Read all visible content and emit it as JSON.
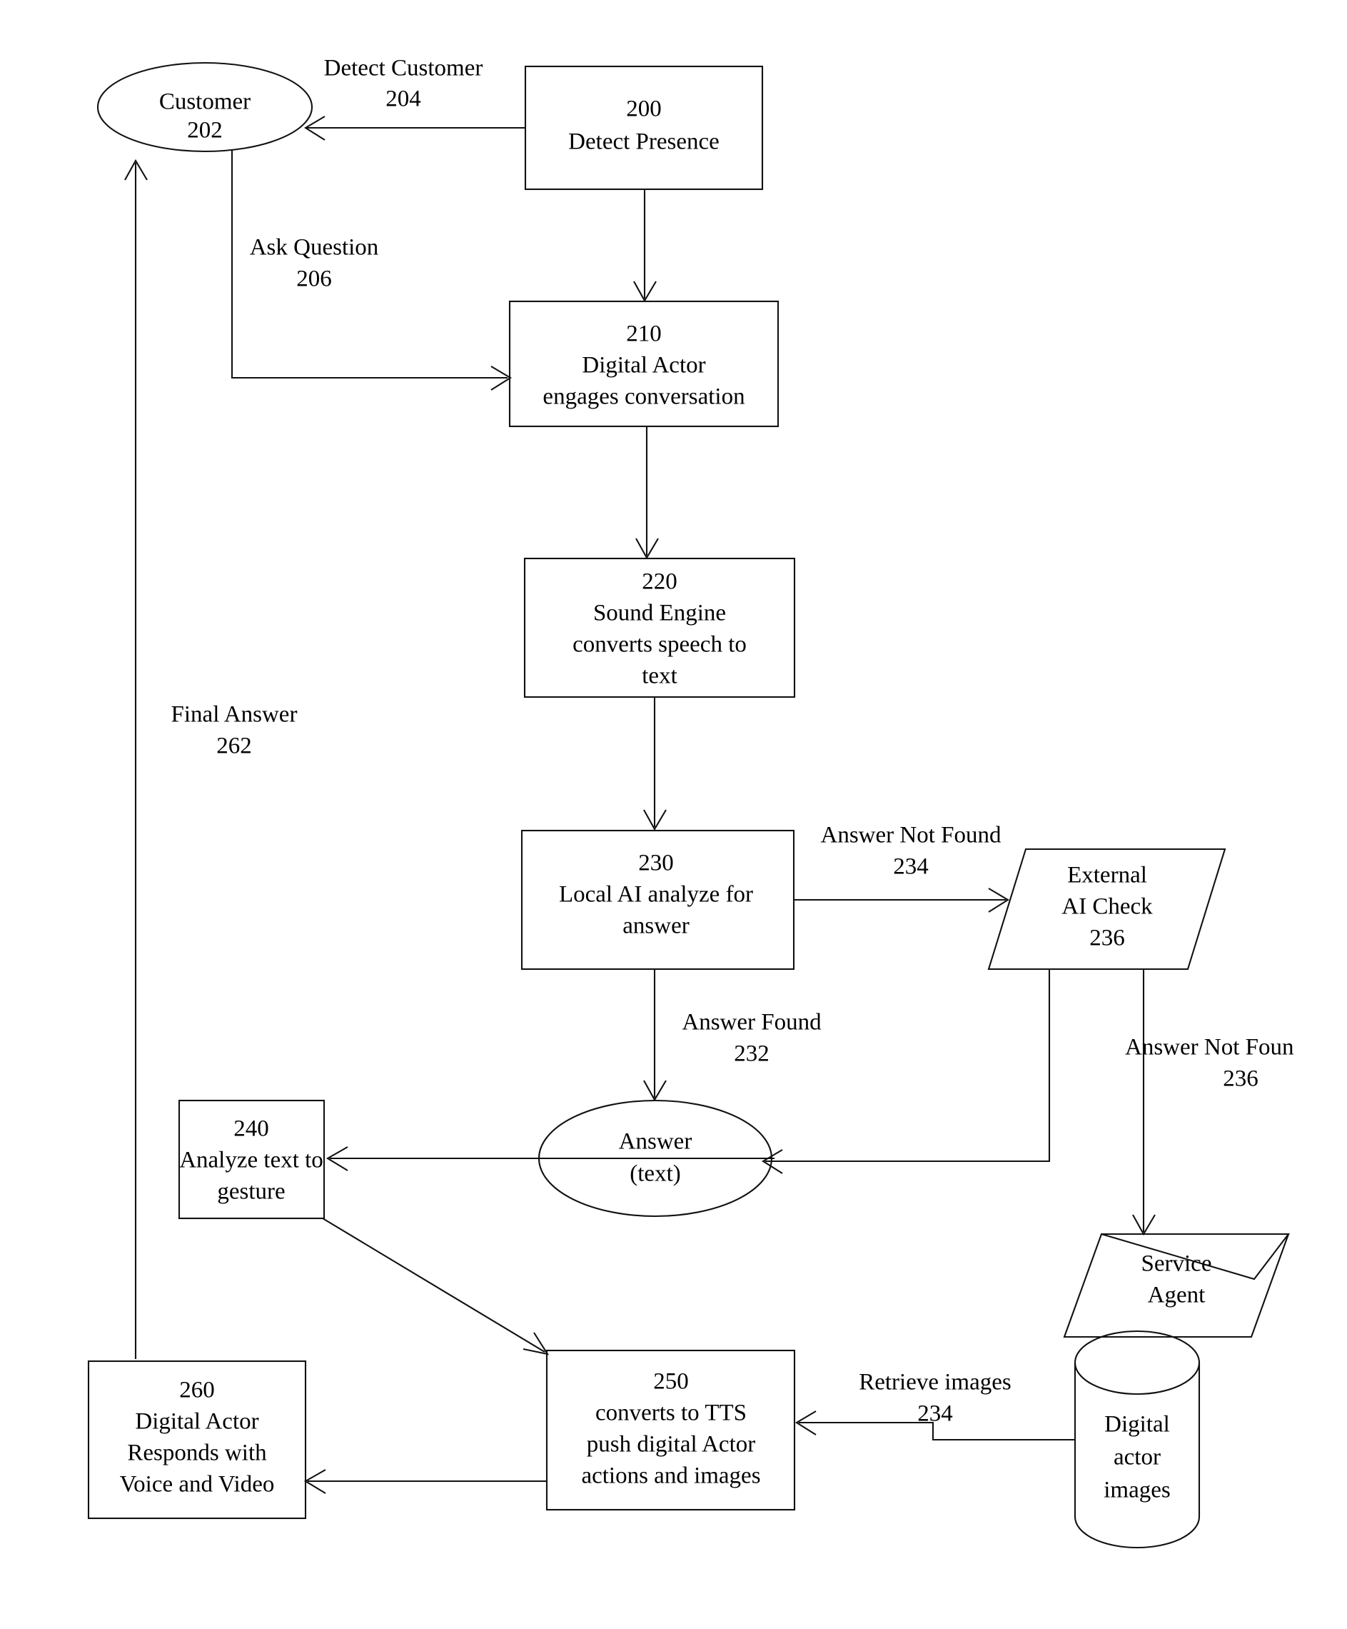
{
  "diagram": {
    "title": "Digital Actor customer service flowchart",
    "stroke_color": "#111111",
    "background_color": "#ffffff",
    "nodes": {
      "customer": {
        "shape": "ellipse",
        "line1": "Customer",
        "line2": "202"
      },
      "detect_presence": {
        "shape": "rect",
        "line1": "200",
        "line2": "Detect Presence"
      },
      "digital_actor": {
        "shape": "rect",
        "line1": "210",
        "line2": "Digital Actor",
        "line3": "engages conversation"
      },
      "sound_engine": {
        "shape": "rect",
        "line1": "220",
        "line2": "Sound Engine",
        "line3": "converts speech to",
        "line4": "text"
      },
      "local_ai": {
        "shape": "rect",
        "line1": "230",
        "line2": "Local AI analyze for",
        "line3": "answer"
      },
      "external_ai": {
        "shape": "parallelogram",
        "line1": "External",
        "line2": "AI Check",
        "line3": "236"
      },
      "service_agent": {
        "shape": "parallelogram",
        "line1": "Service",
        "line2": "Agent"
      },
      "answer": {
        "shape": "ellipse",
        "line1": "Answer",
        "line2": "(text)"
      },
      "analyze_gesture": {
        "shape": "rect",
        "line1": "240",
        "line2": "Analyze text to",
        "line3": "gesture"
      },
      "tts": {
        "shape": "rect",
        "line1": "250",
        "line2": "converts to TTS",
        "line3": "push digital Actor",
        "line4": "actions and images"
      },
      "respond": {
        "shape": "rect",
        "line1": "260",
        "line2": "Digital Actor",
        "line3": "Responds with",
        "line4": "Voice and Video"
      },
      "images_db": {
        "shape": "cylinder",
        "line1": "Digital",
        "line2": "actor",
        "line3": "images"
      }
    },
    "edge_labels": {
      "detect_customer": {
        "line1": "Detect Customer",
        "line2": "204"
      },
      "ask_question": {
        "line1": "Ask Question",
        "line2": "206"
      },
      "final_answer": {
        "line1": "Final Answer",
        "line2": "262"
      },
      "answer_not_found_234": {
        "line1": "Answer Not Found",
        "line2": "234"
      },
      "answer_found_232": {
        "line1": "Answer Found",
        "line2": "232"
      },
      "answer_not_found_236": {
        "line1": "Answer Not Foun",
        "line2": "236"
      },
      "retrieve_images_234": {
        "line1": "Retrieve images",
        "line2": "234"
      }
    }
  }
}
